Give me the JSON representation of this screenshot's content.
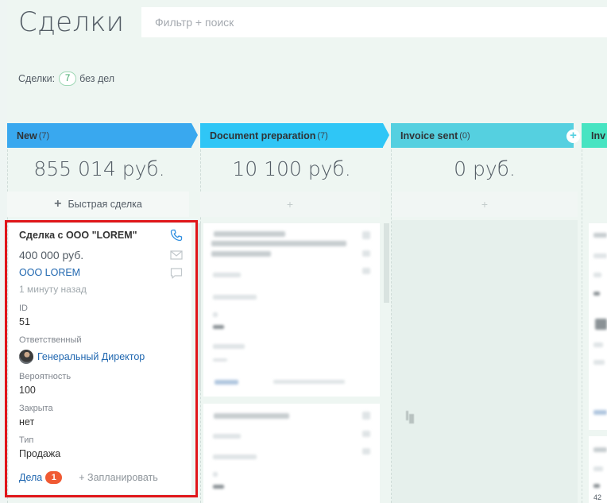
{
  "header": {
    "title": "Сделки",
    "search_placeholder": "Фильтр + поиск"
  },
  "counter": {
    "label": "Сделки:",
    "count": "7",
    "suffix": "без дел"
  },
  "stages": [
    {
      "name": "New",
      "count": "(7)",
      "sum": "855 014 руб.",
      "color": "#39a8ef"
    },
    {
      "name": "Document preparation",
      "count": "(7)",
      "sum": "10 100 руб.",
      "color": "#2fc6f6"
    },
    {
      "name": "Invoice sent",
      "count": "(0)",
      "sum": "0 руб.",
      "color": "#55d0e0"
    },
    {
      "name": "Inv",
      "color": "#47e4c2"
    }
  ],
  "quick_deal": {
    "label": "Быстрая сделка"
  },
  "card": {
    "title": "Сделка с ООО \"LOREM\"",
    "sum": "400 000 руб.",
    "company": "ООО LOREM",
    "time": "1 минуту назад",
    "fields": [
      {
        "label": "ID",
        "value": "51"
      },
      {
        "label": "Ответственный",
        "value": "Генеральный Директор"
      },
      {
        "label": "Вероятность",
        "value": "100"
      },
      {
        "label": "Закрыта",
        "value": "нет"
      },
      {
        "label": "Тип",
        "value": "Продажа"
      }
    ],
    "tasks_label": "Дела",
    "tasks_count": "1",
    "plan_label": "+ Запланировать",
    "icons": [
      "phone-icon",
      "mail-icon",
      "chat-icon"
    ]
  },
  "partial_number": "42"
}
